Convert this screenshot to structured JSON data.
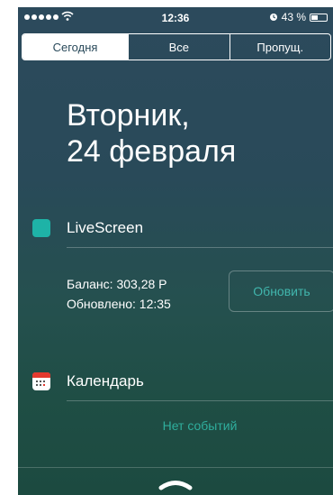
{
  "status_bar": {
    "time": "12:36",
    "battery_text": "43 %",
    "battery_level": 0.43,
    "signal_icon": "signal-dots-icon",
    "wifi_icon": "wifi-icon",
    "alarm_icon": "alarm-icon"
  },
  "tabs": [
    {
      "label": "Сегодня",
      "active": true
    },
    {
      "label": "Все",
      "active": false
    },
    {
      "label": "Пропущ.",
      "active": false
    }
  ],
  "date": {
    "weekday": "Вторник,",
    "day_month": "24 февраля"
  },
  "liveScreen": {
    "title": "LiveScreen",
    "balance": "Баланс: 303,28 Р",
    "updated": "Обновлено: 12:35",
    "refresh_label": "Обновить",
    "icon_color": "#1eb3a7"
  },
  "calendar": {
    "title": "Календарь",
    "no_events": "Нет событий",
    "icon": "calendar-icon"
  },
  "colors": {
    "accent": "#41b6ad",
    "background_top": "#2c4a5c",
    "background_bottom": "#1c4a40"
  }
}
